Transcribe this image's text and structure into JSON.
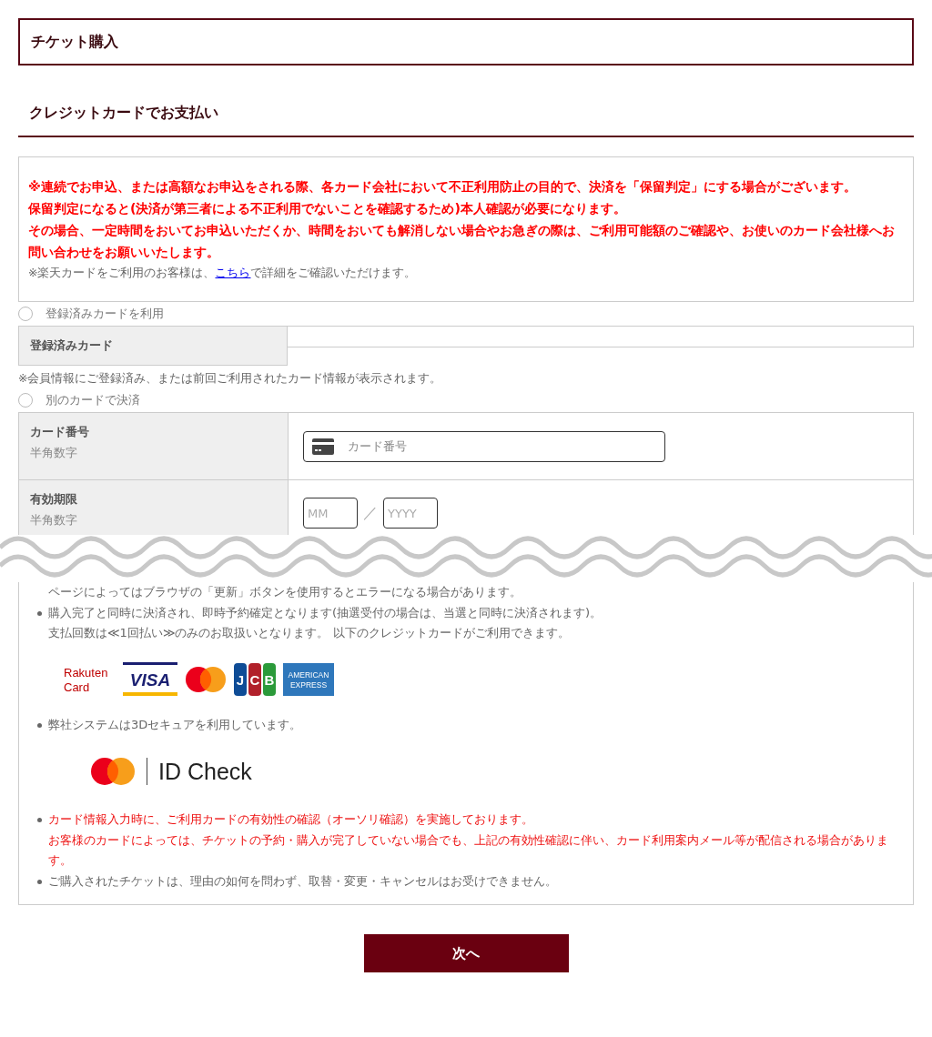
{
  "page_title": "チケット購入",
  "section_heading": "クレジットカードでお支払い",
  "notice": {
    "warnings": [
      "※連続でお申込、または高額なお申込をされる際、各カード会社において不正利用防止の目的で、決済を「保留判定」にする場合がございます。",
      "保留判定になると(決済が第三者による不正利用でないことを確認するため)本人確認が必要になります。",
      "その場合、一定時間をおいてお申込いただくか、時間をおいても解消しない場合やお急ぎの際は、ご利用可能額のご確認や、お使いのカード会社様へお問い合わせをお願いいたします。"
    ],
    "note_before": "※楽天カードをご利用のお客様は、",
    "note_link": "こちら",
    "note_after": "で詳細をご確認いただけます。"
  },
  "saved_card_option": {
    "label": "登録済みカードを利用",
    "selected": false
  },
  "saved_card": {
    "label": "登録済みカード",
    "note": "※会員情報にご登録済み、または前回ご利用されたカード情報が表示されます。"
  },
  "new_card_option": {
    "label": "別のカードで決済",
    "selected": false
  },
  "card_number": {
    "label": "カード番号",
    "sub": "半角数字",
    "placeholder": "カード番号"
  },
  "expiry": {
    "label": "有効期限",
    "sub": "半角数字",
    "month_placeholder": "MM",
    "separator": "／",
    "year_placeholder": "YYYY"
  },
  "notes": [
    {
      "kind": "continuation",
      "lines": [
        "ページによってはブラウザの「更新」ボタンを使用するとエラーになる場合があります。"
      ]
    },
    {
      "kind": "bullet",
      "lines": [
        "購入完了と同時に決済され、即時予約確定となります(抽選受付の場合は、当選と同時に決済されます)。",
        "支払回数は≪1回払い≫のみのお取扱いとなります。 以下のクレジットカードがご利用できます。"
      ]
    },
    {
      "kind": "card_logos",
      "logos": [
        {
          "kind": "rakuten",
          "text": [
            "Rakuten",
            "Card"
          ]
        },
        {
          "kind": "visa",
          "text": [
            "VISA"
          ]
        },
        {
          "kind": "mastercard"
        },
        {
          "kind": "jcb",
          "text": [
            "J",
            "C",
            "B"
          ]
        },
        {
          "kind": "amex",
          "text": [
            "AMERICAN",
            "EXPRESS"
          ]
        }
      ]
    },
    {
      "kind": "bullet",
      "lines": [
        "弊社システムは3Dセキュアを利用しています。"
      ]
    },
    {
      "kind": "id_check",
      "text": "ID Check"
    },
    {
      "kind": "bullet_warning",
      "lines": [
        "カード情報入力時に、ご利用カードの有効性の確認（オーソリ確認）を実施しております。",
        "お客様のカードによっては、チケットの予約・購入が完了していない場合でも、上記の有効性確認に伴い、カード利用案内メール等が配信される場合があります。"
      ]
    },
    {
      "kind": "bullet",
      "lines": [
        "ご購入されたチケットは、理由の如何を問わず、取替・変更・キャンセルはお受けできません。"
      ]
    }
  ],
  "next_button": "次へ"
}
